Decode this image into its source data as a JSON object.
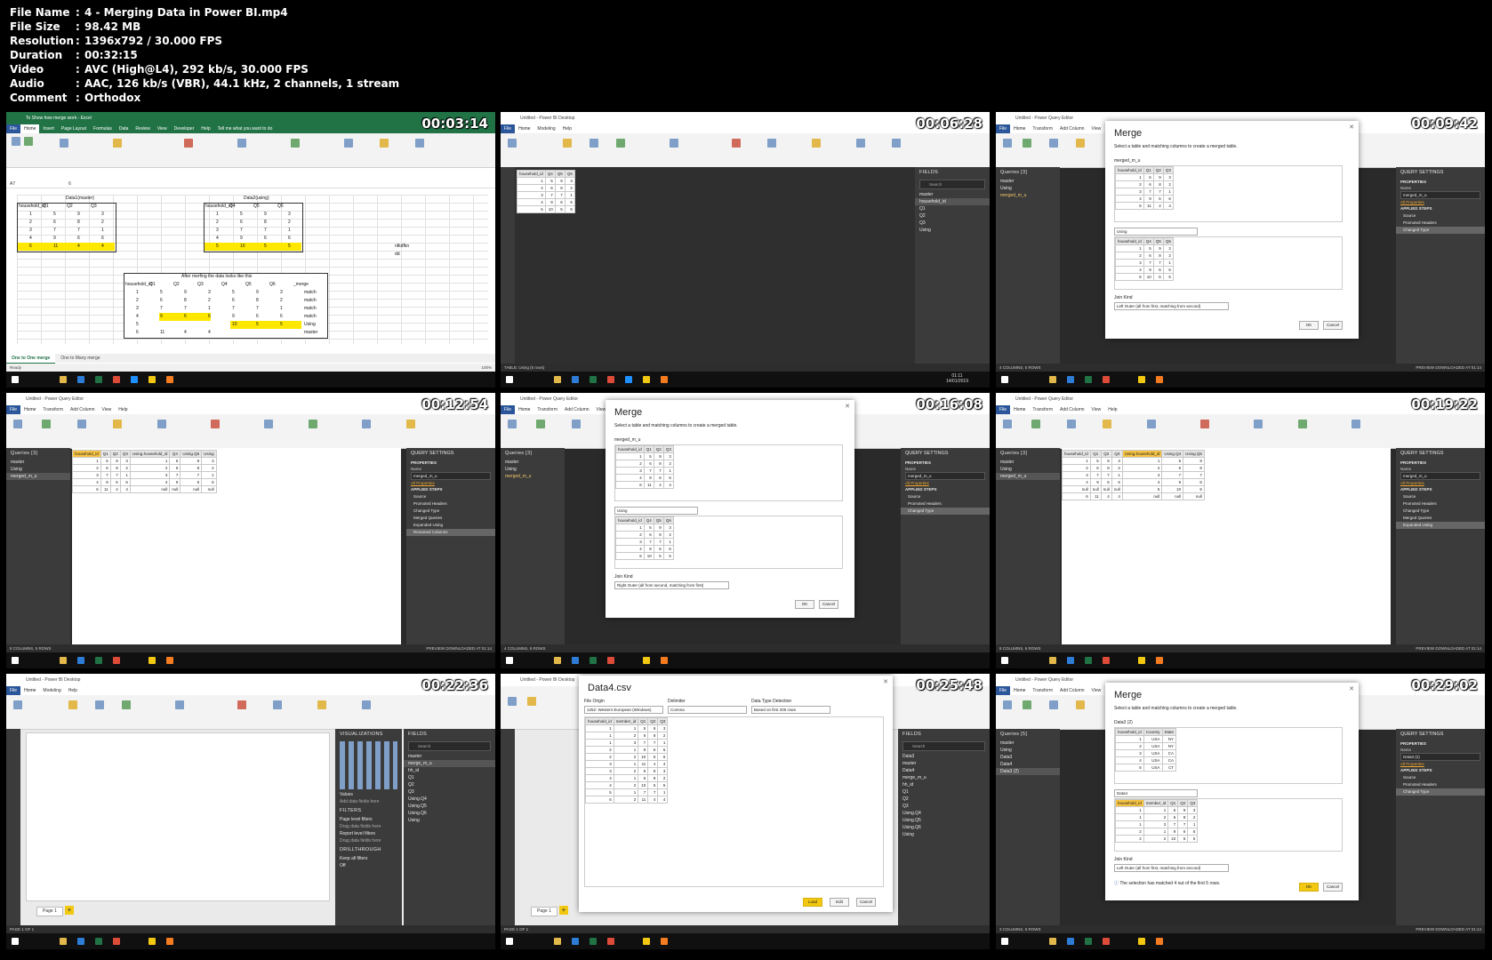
{
  "info": {
    "file_name_label": "File Name",
    "file_name": "4 - Merging Data in Power BI.mp4",
    "file_size_label": "File Size",
    "file_size": "98.42 MB",
    "resolution_label": "Resolution",
    "resolution": "1396x792 / 30.000 FPS",
    "duration_label": "Duration",
    "duration": "00:32:15",
    "video_label": "Video",
    "video": "AVC (High@L4), 292 kb/s, 30.000 FPS",
    "audio_label": "Audio",
    "audio": "AAC, 126 kb/s (VBR), 44.1 kHz, 2 channels, 1 stream",
    "comment_label": "Comment",
    "comment": "Orthodox",
    "separator": ":"
  },
  "frames": [
    {
      "timestamp": "00:03:14"
    },
    {
      "timestamp": "00:06:28"
    },
    {
      "timestamp": "00:09:42"
    },
    {
      "timestamp": "00:12:54"
    },
    {
      "timestamp": "00:16:08"
    },
    {
      "timestamp": "00:19:22"
    },
    {
      "timestamp": "00:22:36"
    },
    {
      "timestamp": "00:25:48"
    },
    {
      "timestamp": "00:29:02"
    }
  ],
  "excel": {
    "title": "To Show how merge work - Excel",
    "tabs": [
      "File",
      "Home",
      "Insert",
      "Page Layout",
      "Formulas",
      "Data",
      "Review",
      "View",
      "Developer",
      "Help",
      "Tell me what you want to do"
    ],
    "data1_title": "Data1(master)",
    "data2_title": "Data2(using)",
    "after_title": "After merfing the data looks like this",
    "headers1": [
      "household_id",
      "Q1",
      "Q2",
      "Q3"
    ],
    "headers2": [
      "household_id",
      "Q4",
      "Q5",
      "Q6"
    ],
    "rows1": [
      [
        "1",
        "5",
        "9",
        "3"
      ],
      [
        "2",
        "6",
        "8",
        "2"
      ],
      [
        "3",
        "7",
        "7",
        "1"
      ],
      [
        "4",
        "9",
        "6",
        "6"
      ],
      [
        "6",
        "11",
        "4",
        "4"
      ]
    ],
    "rows2": [
      [
        "1",
        "5",
        "9",
        "3"
      ],
      [
        "2",
        "6",
        "8",
        "2"
      ],
      [
        "3",
        "7",
        "7",
        "1"
      ],
      [
        "4",
        "9",
        "6",
        "6"
      ],
      [
        "5",
        "10",
        "5",
        "5"
      ]
    ],
    "merged_headers": [
      "household_id",
      "Q1",
      "Q2",
      "Q3",
      "Q4",
      "Q5",
      "Q6",
      "_merge"
    ],
    "merged_rows": [
      [
        "1",
        "5",
        "9",
        "3",
        "5",
        "9",
        "3",
        "match"
      ],
      [
        "2",
        "6",
        "8",
        "2",
        "6",
        "8",
        "2",
        "match"
      ],
      [
        "3",
        "7",
        "7",
        "1",
        "7",
        "7",
        "1",
        "match"
      ],
      [
        "4",
        "9",
        "6",
        "6",
        "9",
        "6",
        "6",
        "match"
      ],
      [
        "5",
        "",
        "",
        "",
        "10",
        "5",
        "5",
        "Using"
      ],
      [
        "6",
        "11",
        "4",
        "4",
        "",
        "",
        "",
        "master"
      ]
    ],
    "side_note": [
      "nfkdfkn",
      "dd"
    ],
    "sheet_tabs": [
      "One to One merge",
      "One to Many merge"
    ],
    "status": "Ready",
    "zoom": "100%",
    "name_box": "A7",
    "formula": "6"
  },
  "pbi": {
    "title": "Untitled - Power BI Desktop",
    "tabs": [
      "File",
      "Home",
      "Modeling",
      "Help"
    ],
    "fields_title": "FIELDS",
    "search": "Search",
    "fields": [
      "master",
      "household_id",
      "Q1",
      "Q2",
      "Q3",
      "Using"
    ],
    "table_headers": [
      "household_id",
      "Q4",
      "Q5",
      "Q6"
    ],
    "table_rows": [
      [
        "1",
        "5",
        "9",
        "3"
      ],
      [
        "2",
        "6",
        "8",
        "2"
      ],
      [
        "3",
        "7",
        "7",
        "1"
      ],
      [
        "4",
        "9",
        "6",
        "6"
      ],
      [
        "5",
        "10",
        "5",
        "5"
      ]
    ],
    "status": "TABLE: Using (5 rows)",
    "clock_time": "01:11",
    "clock_date": "14/01/2019"
  },
  "pq": {
    "title": "Untitled - Power Query Editor",
    "tabs": [
      "File",
      "Home",
      "Transform",
      "Add Column",
      "View",
      "Help"
    ],
    "queries_title": "Queries [3]",
    "queries": [
      "master",
      "Using",
      "merged_m_u"
    ],
    "settings_title": "QUERY SETTINGS",
    "properties": "PROPERTIES",
    "name_label": "Name",
    "name_value": "merged_m_u",
    "all_props": "All Properties",
    "applied": "APPLIED STEPS",
    "steps": [
      "Source",
      "Promoted Headers",
      "Changed Type"
    ],
    "steps_f4": [
      "Source",
      "Promoted Headers",
      "Changed Type",
      "Merged Queries",
      "Expanded Using",
      "Renamed Columns"
    ],
    "steps_f6": [
      "Source",
      "Promoted Headers",
      "Changed Type",
      "Merged Queries",
      "Expanded Using"
    ],
    "headers_f4": [
      "household_id",
      "Q1",
      "Q2",
      "Q3",
      "Using.household_id",
      "Q4",
      "Using.Q5",
      "Using"
    ],
    "rows_f4": [
      [
        "1",
        "5",
        "9",
        "3",
        "1",
        "5",
        "9",
        "3"
      ],
      [
        "2",
        "6",
        "8",
        "2",
        "2",
        "6",
        "8",
        "2"
      ],
      [
        "3",
        "7",
        "7",
        "1",
        "3",
        "7",
        "7",
        "1"
      ],
      [
        "4",
        "9",
        "6",
        "6",
        "4",
        "9",
        "6",
        "6"
      ],
      [
        "6",
        "11",
        "4",
        "4",
        "null",
        "null",
        "null",
        "null"
      ]
    ],
    "headers_f6": [
      "household_id",
      "Q1",
      "Q2",
      "Q3",
      "Using.household_id",
      "Using.Q4",
      "Using.Q5"
    ],
    "rows_f6": [
      [
        "1",
        "5",
        "9",
        "3",
        "1",
        "5",
        "9"
      ],
      [
        "2",
        "6",
        "8",
        "2",
        "2",
        "6",
        "8"
      ],
      [
        "3",
        "7",
        "7",
        "1",
        "3",
        "7",
        "7"
      ],
      [
        "4",
        "9",
        "6",
        "6",
        "4",
        "9",
        "6"
      ],
      [
        "null",
        "null",
        "null",
        "null",
        "5",
        "10",
        "5"
      ],
      [
        "6",
        "11",
        "4",
        "4",
        "null",
        "null",
        "null"
      ]
    ],
    "status_f3": "4 COLUMNS, 5 ROWS",
    "status_f4": "8 COLUMNS, 5 ROWS",
    "status_f6": "8 COLUMNS, 6 ROWS",
    "status_f9": "3 COLUMNS, 5 ROWS",
    "preview": "PREVIEW DOWNLOADED AT 01:14",
    "queries_f9_title": "Queries [5]",
    "queries_f9": [
      "master",
      "Using",
      "Data3",
      "Data4",
      "Data3 (2)"
    ],
    "name_f9": "Data3 (2)"
  },
  "merge": {
    "title": "Merge",
    "desc": "Select a table and matching columns to create a merged table.",
    "table1": "merged_m_u",
    "table2": "Using",
    "h1": [
      "household_id",
      "Q1",
      "Q2",
      "Q3"
    ],
    "r1": [
      [
        "1",
        "5",
        "9",
        "3"
      ],
      [
        "2",
        "6",
        "8",
        "2"
      ],
      [
        "3",
        "7",
        "7",
        "1"
      ],
      [
        "4",
        "9",
        "6",
        "6"
      ],
      [
        "6",
        "11",
        "4",
        "4"
      ]
    ],
    "h2": [
      "household_id",
      "Q4",
      "Q5",
      "Q6"
    ],
    "r2": [
      [
        "1",
        "5",
        "9",
        "3"
      ],
      [
        "2",
        "6",
        "8",
        "2"
      ],
      [
        "3",
        "7",
        "7",
        "1"
      ],
      [
        "4",
        "9",
        "6",
        "6"
      ],
      [
        "5",
        "10",
        "5",
        "5"
      ]
    ],
    "join_kind_label": "Join Kind",
    "join_kind_f3": "Left Outer (all from first, matching from second)",
    "join_kind_f5": "Right Outer (all from second, matching from first)",
    "ok": "OK",
    "cancel": "Cancel",
    "f9_table1": "Data3 (2)",
    "f9_table2": "Data4",
    "f9_h1": [
      "household_id",
      "Country",
      "State"
    ],
    "f9_r1": [
      [
        "1",
        "USA",
        "NY"
      ],
      [
        "2",
        "USA",
        "NY"
      ],
      [
        "3",
        "USA",
        "CA"
      ],
      [
        "4",
        "USA",
        "CA"
      ],
      [
        "6",
        "USA",
        "CT"
      ]
    ],
    "f9_h2": [
      "household_id",
      "member_id",
      "Q1",
      "Q2",
      "Q3"
    ],
    "f9_r2": [
      [
        "1",
        "1",
        "5",
        "9",
        "3"
      ],
      [
        "1",
        "2",
        "6",
        "8",
        "2"
      ],
      [
        "1",
        "3",
        "7",
        "7",
        "1"
      ],
      [
        "2",
        "1",
        "9",
        "6",
        "6"
      ],
      [
        "2",
        "2",
        "10",
        "5",
        "5"
      ]
    ],
    "f9_info": "The selection has matched 4 out of the first 5 rows."
  },
  "report": {
    "viz_title": "VISUALIZATIONS",
    "fields_title": "FIELDS",
    "values": "Values",
    "add_fields": "Add data fields here",
    "filters": "FILTERS",
    "page_filters": "Page level filters",
    "drag": "Drag data fields here",
    "report_filters": "Report level filters",
    "drill": "DRILLTHROUGH",
    "keep": "Keep all filters",
    "off": "Off",
    "page_tab": "Page 1",
    "add": "+",
    "fields": [
      "master",
      "merge_m_u",
      "hh_id",
      "Q1",
      "Q2",
      "Q3",
      "Using.Q4",
      "Using.Q5",
      "Using.Q6",
      "Using"
    ],
    "page_of": "PAGE 1 OF 1"
  },
  "csv": {
    "title": "Data4.csv",
    "origin_label": "File Origin",
    "origin": "1252: Western European (Windows)",
    "delim_label": "Delimiter",
    "delim": "Comma",
    "detect_label": "Data Type Detection",
    "detect": "Based on first 200 rows",
    "headers": [
      "household_id",
      "member_id",
      "Q1",
      "Q2",
      "Q3"
    ],
    "rows": [
      [
        "1",
        "1",
        "5",
        "9",
        "3"
      ],
      [
        "1",
        "2",
        "6",
        "8",
        "2"
      ],
      [
        "1",
        "3",
        "7",
        "7",
        "1"
      ],
      [
        "2",
        "1",
        "9",
        "6",
        "6"
      ],
      [
        "2",
        "2",
        "10",
        "5",
        "5"
      ],
      [
        "3",
        "1",
        "11",
        "4",
        "4"
      ],
      [
        "3",
        "2",
        "5",
        "9",
        "3"
      ],
      [
        "4",
        "1",
        "6",
        "8",
        "2"
      ],
      [
        "4",
        "2",
        "10",
        "5",
        "5"
      ],
      [
        "5",
        "1",
        "7",
        "7",
        "1"
      ],
      [
        "6",
        "2",
        "11",
        "4",
        "4"
      ]
    ],
    "load": "Load",
    "edit": "Edit",
    "cancel": "Cancel",
    "fields": [
      "Data3",
      "master",
      "Data4",
      "merge_m_u",
      "hh_id",
      "Q1",
      "Q2",
      "Q3",
      "Using.Q4",
      "Using.Q5",
      "Using.Q6",
      "Using"
    ]
  },
  "colors": {
    "pbi_yellow": "#f2c811",
    "excel_green": "#217346",
    "dark_panel": "#3b3b3b",
    "highlight": "#ffe800"
  }
}
